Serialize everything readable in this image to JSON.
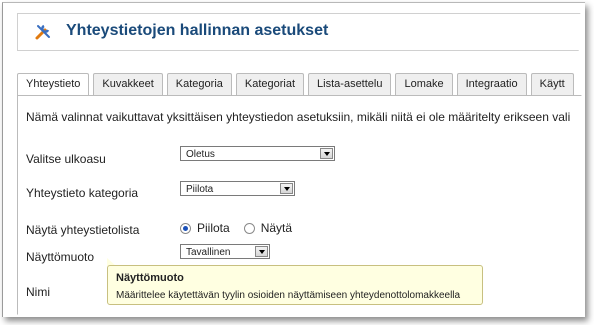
{
  "header": {
    "title": "Yhteystietojen hallinnan asetukset",
    "icon": "tools-icon"
  },
  "tabs": [
    {
      "label": "Yhteystieto",
      "active": true
    },
    {
      "label": "Kuvakkeet"
    },
    {
      "label": "Kategoria"
    },
    {
      "label": "Kategoriat"
    },
    {
      "label": "Lista-asettelu"
    },
    {
      "label": "Lomake"
    },
    {
      "label": "Integraatio"
    },
    {
      "label": "Käytt"
    }
  ],
  "panel": {
    "description": "Nämä valinnat vaikuttavat yksittäisen yhteystiedon asetuksiin, mikäli niitä ei ole määritelty erikseen vali",
    "fields": {
      "layout": {
        "label": "Valitse ulkoasu",
        "value": "Oletus"
      },
      "category": {
        "label": "Yhteystieto kategoria",
        "value": "Piilota"
      },
      "contact_list": {
        "label": "Näytä yhteystietolista",
        "options": [
          "Piilota",
          "Näytä"
        ],
        "selected": "Piilota"
      },
      "display_format": {
        "label": "Näyttömuoto",
        "value": "Tavallinen"
      },
      "name": {
        "label": "Nimi"
      }
    }
  },
  "tooltip": {
    "title": "Näyttömuoto",
    "text": "Määrittelee käytettävän tyylin osioiden näyttämiseen yhteydenottolomakkeella"
  }
}
